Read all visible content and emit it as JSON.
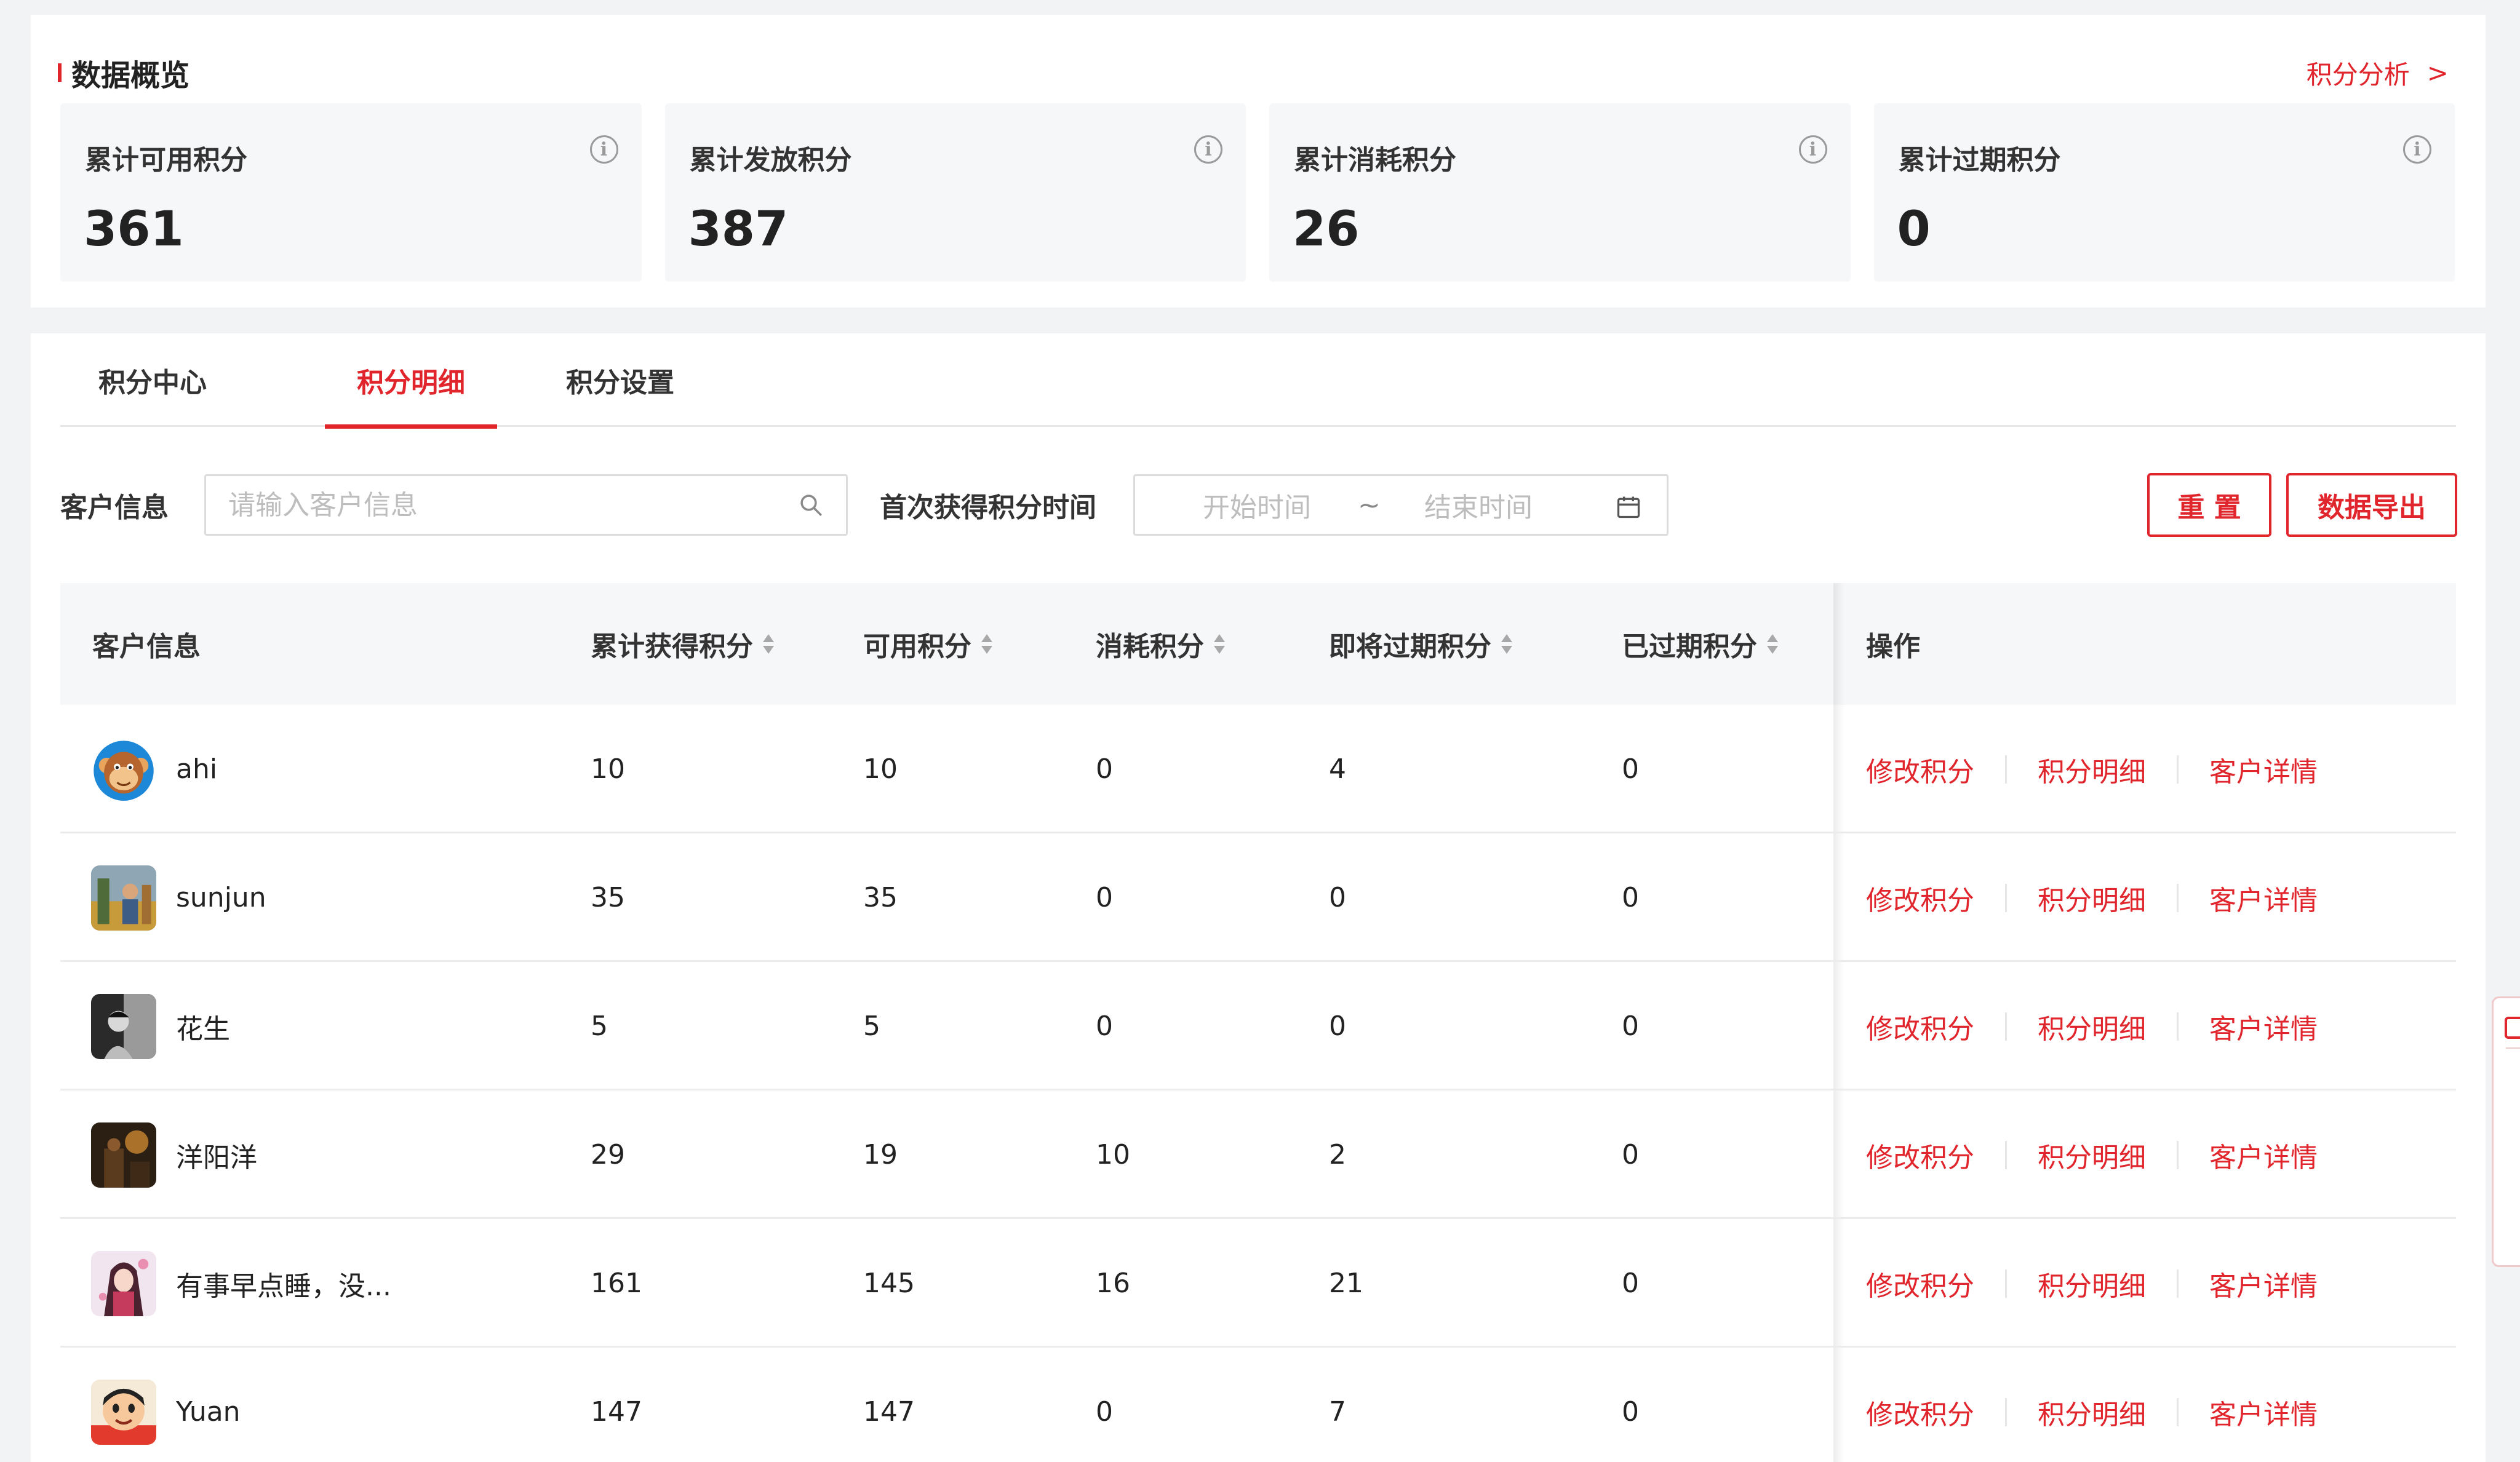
{
  "overview": {
    "title": "数据概览",
    "link_label": "积分分析",
    "link_chevron": ">",
    "stats": [
      {
        "label": "累计可用积分",
        "value": "361",
        "info": "i"
      },
      {
        "label": "累计发放积分",
        "value": "387",
        "info": "i"
      },
      {
        "label": "累计消耗积分",
        "value": "26",
        "info": "i"
      },
      {
        "label": "累计过期积分",
        "value": "0",
        "info": "i"
      }
    ]
  },
  "tabs": [
    "积分中心",
    "积分明细",
    "积分设置"
  ],
  "active_tab": "积分明细",
  "filters": {
    "customer_label": "客户信息",
    "customer_placeholder": "请输入客户信息",
    "customer_value": "",
    "date_label": "首次获得积分时间",
    "date_start_placeholder": "开始时间",
    "date_separator": "~",
    "date_end_placeholder": "结束时间",
    "reset_label": "重 置",
    "export_label": "数据导出"
  },
  "table": {
    "headers": {
      "customer": "客户信息",
      "total_earned": "累计获得积分",
      "available": "可用积分",
      "consumed": "消耗积分",
      "expiring": "即将过期积分",
      "expired": "已过期积分",
      "actions": "操作"
    },
    "actions": [
      "修改积分",
      "积分明细",
      "客户详情"
    ],
    "rows": [
      {
        "name": "ahi",
        "total_earned": "10",
        "available": "10",
        "consumed": "0",
        "expiring": "4",
        "expired": "0",
        "avatar": "monkey-avatar"
      },
      {
        "name": "sunjun",
        "total_earned": "35",
        "available": "35",
        "consumed": "0",
        "expiring": "0",
        "expired": "0",
        "avatar": "photo-avatar"
      },
      {
        "name": "花生",
        "total_earned": "5",
        "available": "5",
        "consumed": "0",
        "expiring": "0",
        "expired": "0",
        "avatar": "bw-photo-avatar"
      },
      {
        "name": "洋阳洋",
        "total_earned": "29",
        "available": "19",
        "consumed": "10",
        "expiring": "2",
        "expired": "0",
        "avatar": "dark-photo-avatar"
      },
      {
        "name": "有事早点睡，没...",
        "total_earned": "161",
        "available": "145",
        "consumed": "16",
        "expiring": "21",
        "expired": "0",
        "avatar": "anime-avatar"
      },
      {
        "name": "Yuan",
        "total_earned": "147",
        "available": "147",
        "consumed": "0",
        "expiring": "7",
        "expired": "0",
        "avatar": "cartoon-avatar"
      }
    ]
  },
  "colors": {
    "accent": "#e0252c",
    "background": "#f2f3f5",
    "card": "#ffffff",
    "stat_bg": "#f6f7f9"
  }
}
